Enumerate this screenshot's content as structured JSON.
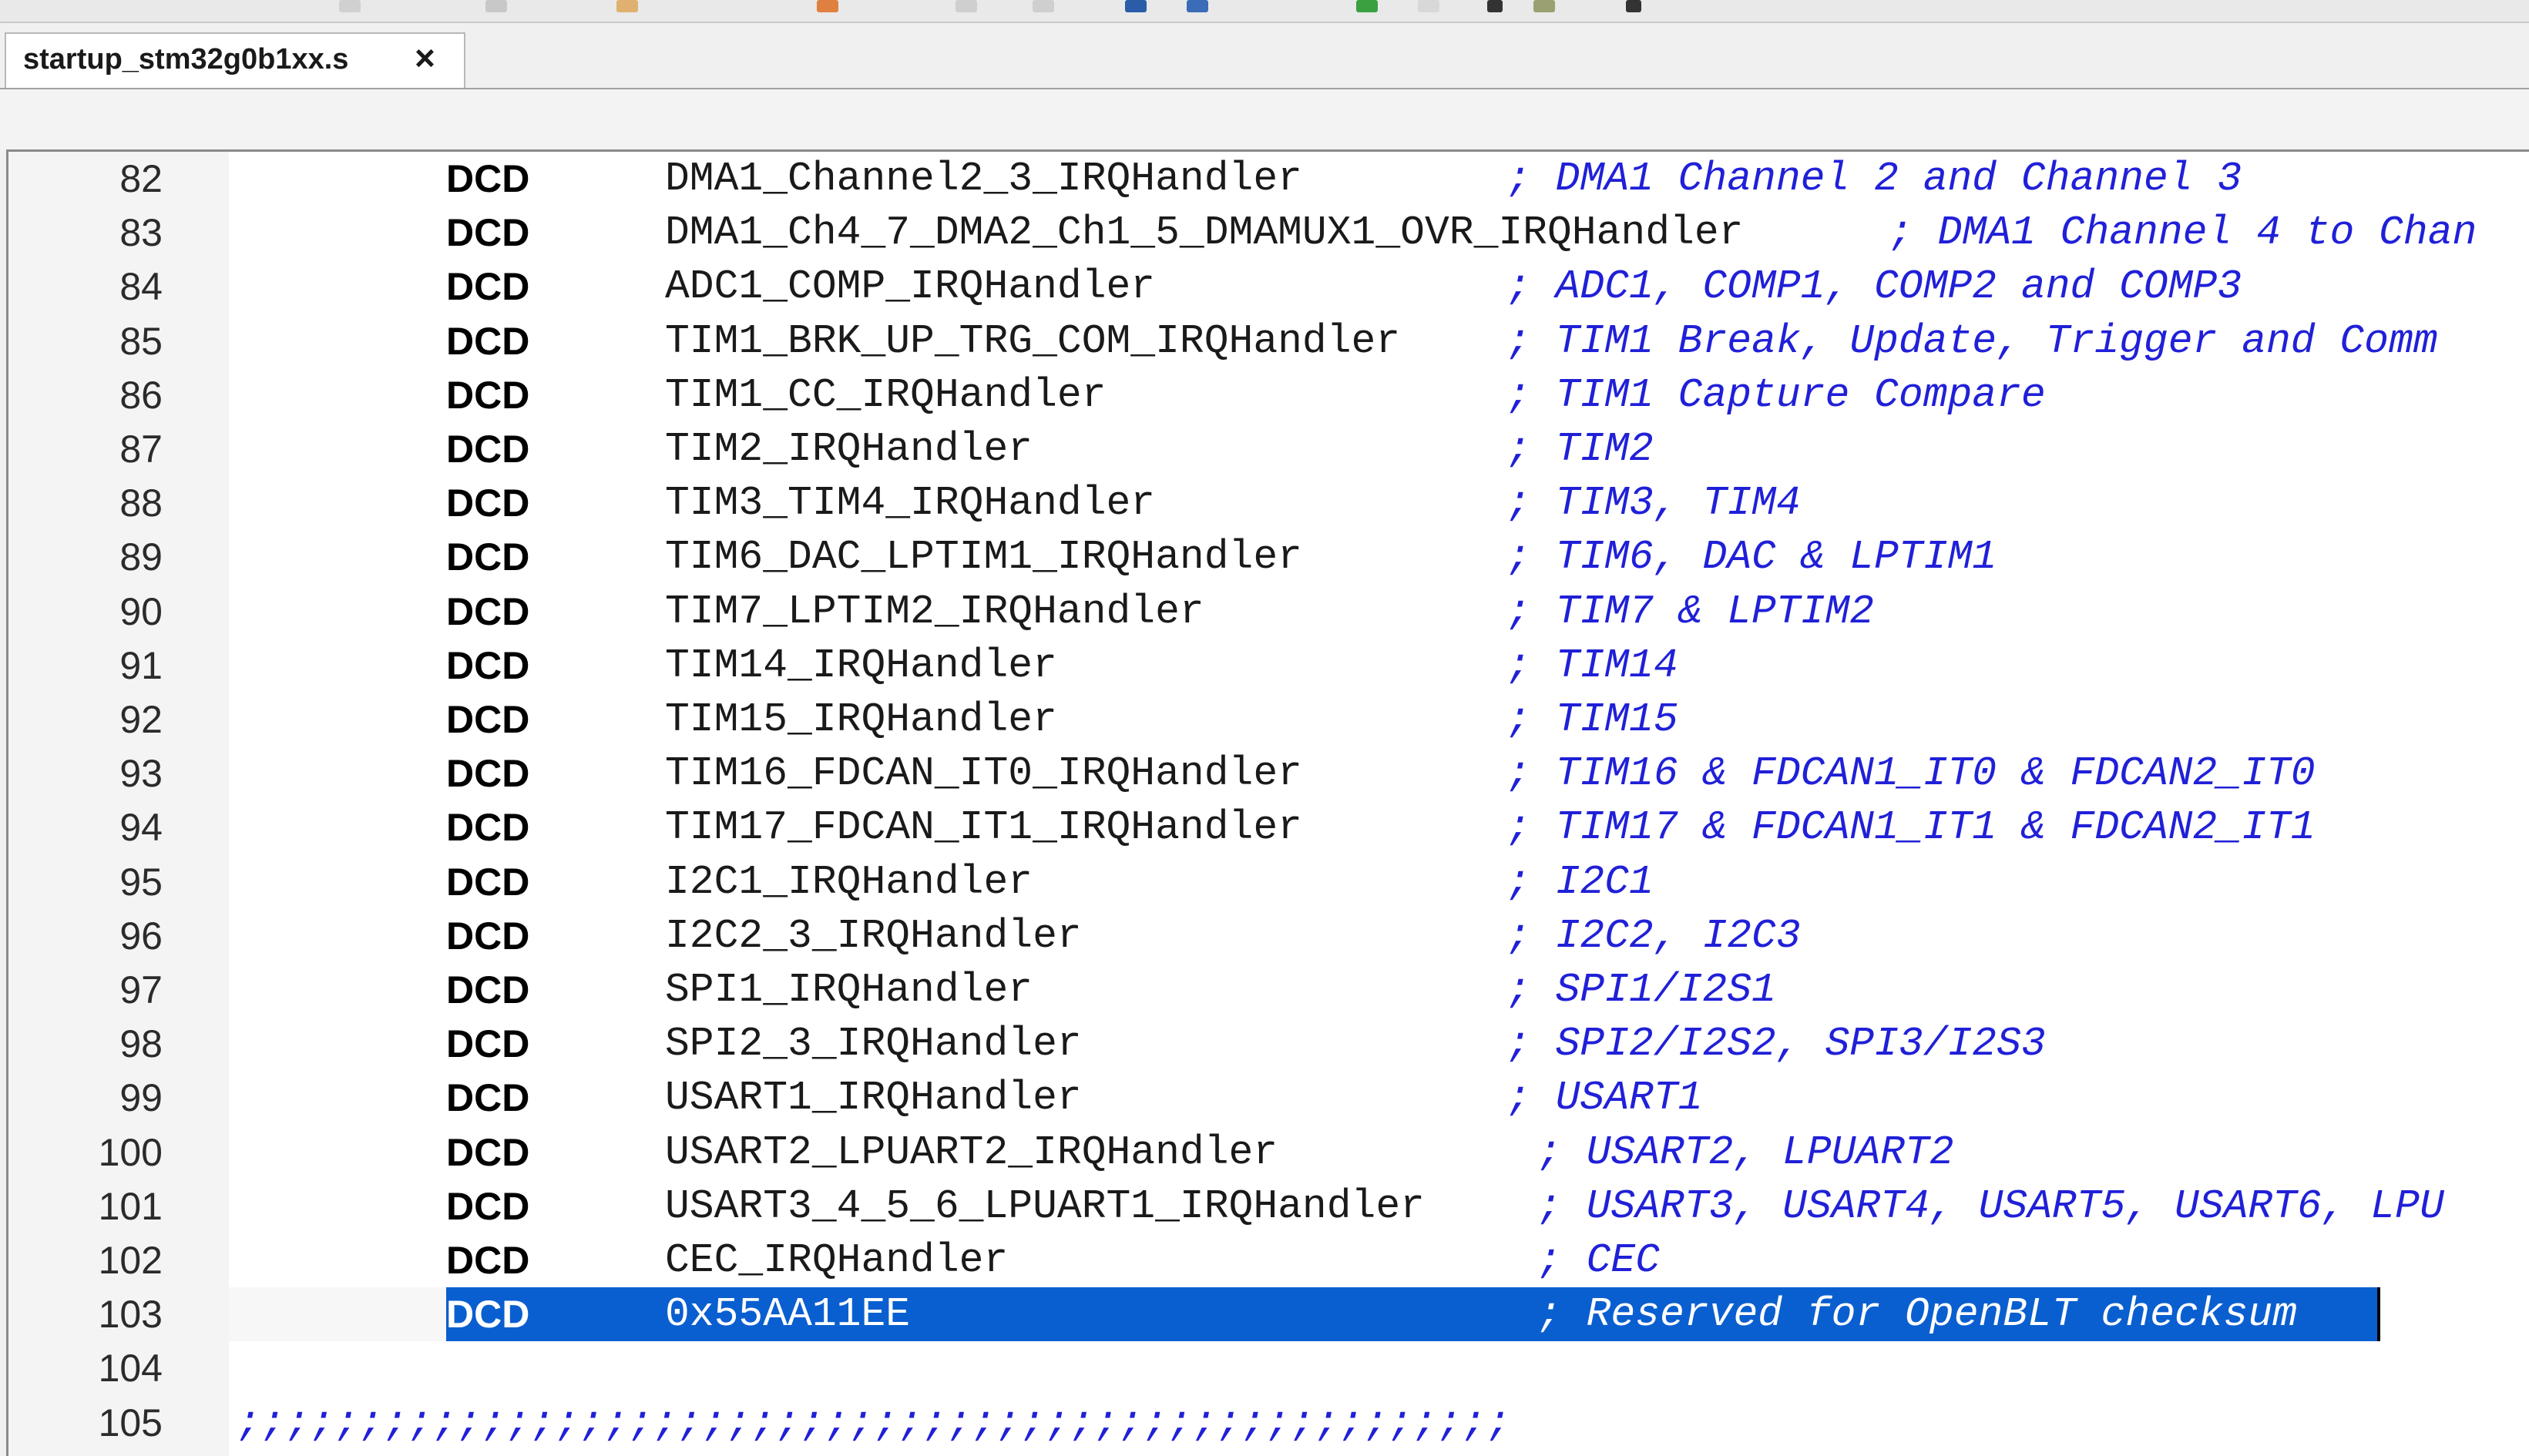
{
  "tab": {
    "filename": "startup_stm32g0b1xx.s",
    "close_glyph": "×"
  },
  "lines": [
    {
      "num": "82",
      "directive": "DCD",
      "symbol": "DMA1_Channel2_3_IRQHandler",
      "comment": "; DMA1 Channel 2 and Channel 3"
    },
    {
      "num": "83",
      "directive": "DCD",
      "symbol": "DMA1_Ch4_7_DMA2_Ch1_5_DMAMUX1_OVR_IRQHandler",
      "comment": "; DMA1 Channel 4 to Chan"
    },
    {
      "num": "84",
      "directive": "DCD",
      "symbol": "ADC1_COMP_IRQHandler",
      "comment": "; ADC1, COMP1, COMP2 and COMP3"
    },
    {
      "num": "85",
      "directive": "DCD",
      "symbol": "TIM1_BRK_UP_TRG_COM_IRQHandler",
      "comment": "; TIM1 Break, Update, Trigger and Comm"
    },
    {
      "num": "86",
      "directive": "DCD",
      "symbol": "TIM1_CC_IRQHandler",
      "comment": "; TIM1 Capture Compare"
    },
    {
      "num": "87",
      "directive": "DCD",
      "symbol": "TIM2_IRQHandler",
      "comment": "; TIM2"
    },
    {
      "num": "88",
      "directive": "DCD",
      "symbol": "TIM3_TIM4_IRQHandler",
      "comment": "; TIM3, TIM4"
    },
    {
      "num": "89",
      "directive": "DCD",
      "symbol": "TIM6_DAC_LPTIM1_IRQHandler",
      "comment": "; TIM6, DAC & LPTIM1"
    },
    {
      "num": "90",
      "directive": "DCD",
      "symbol": "TIM7_LPTIM2_IRQHandler",
      "comment": "; TIM7 & LPTIM2"
    },
    {
      "num": "91",
      "directive": "DCD",
      "symbol": "TIM14_IRQHandler",
      "comment": "; TIM14"
    },
    {
      "num": "92",
      "directive": "DCD",
      "symbol": "TIM15_IRQHandler",
      "comment": "; TIM15"
    },
    {
      "num": "93",
      "directive": "DCD",
      "symbol": "TIM16_FDCAN_IT0_IRQHandler",
      "comment": "; TIM16 & FDCAN1_IT0 & FDCAN2_IT0"
    },
    {
      "num": "94",
      "directive": "DCD",
      "symbol": "TIM17_FDCAN_IT1_IRQHandler",
      "comment": "; TIM17 & FDCAN1_IT1 & FDCAN2_IT1"
    },
    {
      "num": "95",
      "directive": "DCD",
      "symbol": "I2C1_IRQHandler",
      "comment": "; I2C1"
    },
    {
      "num": "96",
      "directive": "DCD",
      "symbol": "I2C2_3_IRQHandler",
      "comment": "; I2C2, I2C3"
    },
    {
      "num": "97",
      "directive": "DCD",
      "symbol": "SPI1_IRQHandler",
      "comment": "; SPI1/I2S1"
    },
    {
      "num": "98",
      "directive": "DCD",
      "symbol": "SPI2_3_IRQHandler",
      "comment": "; SPI2/I2S2, SPI3/I2S3"
    },
    {
      "num": "99",
      "directive": "DCD",
      "symbol": "USART1_IRQHandler",
      "comment": "; USART1"
    },
    {
      "num": "100",
      "directive": "DCD",
      "symbol": "USART2_LPUART2_IRQHandler",
      "comment": "; USART2, LPUART2"
    },
    {
      "num": "101",
      "directive": "DCD",
      "symbol": "USART3_4_5_6_LPUART1_IRQHandler",
      "comment": "; USART3, USART4, USART5, USART6, LPU"
    },
    {
      "num": "102",
      "directive": "DCD",
      "symbol": "CEC_IRQHandler",
      "comment": "; CEC"
    },
    {
      "num": "103",
      "directive": "DCD",
      "symbol": "0x55AA11EE",
      "comment": "; Reserved for OpenBLT checksum"
    },
    {
      "num": "104",
      "directive": "",
      "symbol": "",
      "comment": ""
    },
    {
      "num": "105",
      "directive": "",
      "symbol": "",
      "comment": ";;;;;;;;;;;;;;;;;;;;;;;;;;;;;;;;;;;;;;;;;;;;;;;;;;;;"
    }
  ],
  "colors": {
    "comment": "#2020d8",
    "selection": "#0a5fd0",
    "gutter": "#f4f4f4"
  }
}
